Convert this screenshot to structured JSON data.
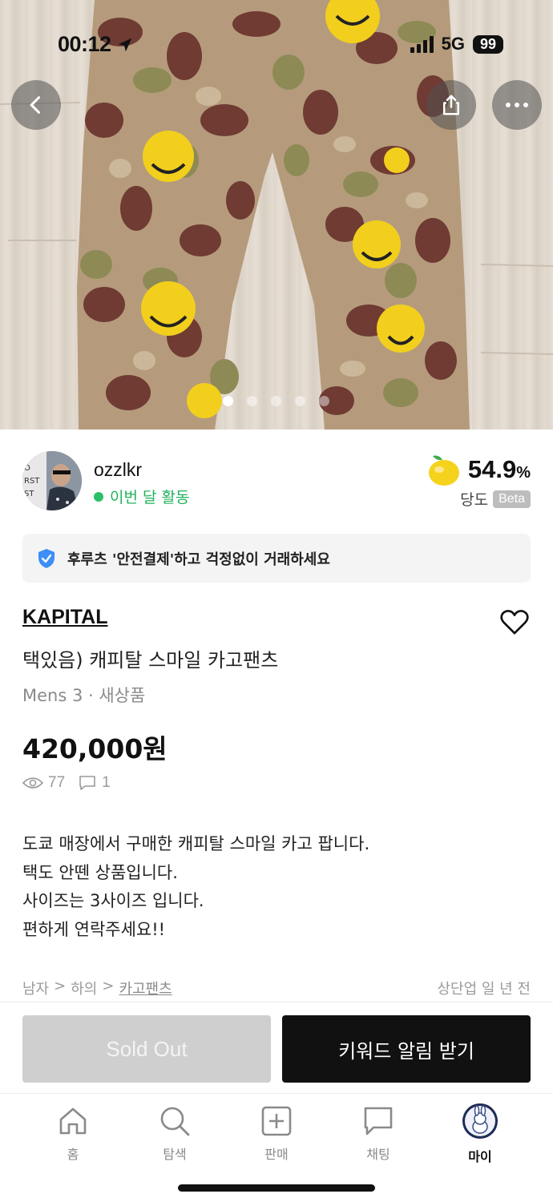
{
  "status_bar": {
    "time": "00:12",
    "network": "5G",
    "battery": "99"
  },
  "gallery": {
    "total_images": 5,
    "active_index": 0
  },
  "seller": {
    "username": "ozzlkr",
    "activity": "이번 달 활동",
    "sweetness_value": "54.9",
    "sweetness_unit": "%",
    "sweetness_label": "당도",
    "beta_badge": "Beta"
  },
  "safe_pay": {
    "text": "후루츠 '안전결제'하고 걱정없이 거래하세요"
  },
  "product": {
    "brand": "KAPITAL",
    "title": "택있음) 캐피탈 스마일 카고팬츠",
    "meta": "Mens 3 · 새상품",
    "price": "420,000원",
    "views": "77",
    "comments": "1",
    "description": [
      "도쿄 매장에서 구매한 캐피탈 스마일 카고 팝니다.",
      "택도 안뗀 상품입니다.",
      "사이즈는 3사이즈 입니다.",
      "편하게 연락주세요!!"
    ],
    "breadcrumb": {
      "level1": "남자",
      "sep": ">",
      "level2": "하의",
      "level3": "카고팬츠"
    },
    "posted": "상단업 일 년 전"
  },
  "actions": {
    "sold_out": "Sold Out",
    "keyword_alert": "키워드 알림 받기"
  },
  "tabbar": {
    "home": "홈",
    "explore": "탐색",
    "sell": "판매",
    "chat": "채팅",
    "my": "마이"
  },
  "colors": {
    "accent_green": "#21b35a",
    "primary_black": "#111111",
    "sold_out_gray": "#cfcfcf"
  }
}
